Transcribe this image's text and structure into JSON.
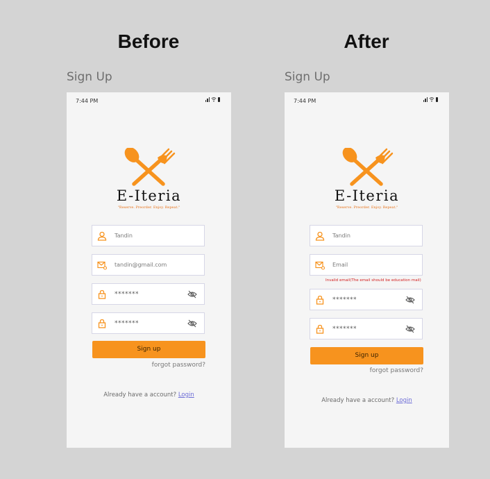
{
  "headings": {
    "before": "Before",
    "after": "After"
  },
  "before": {
    "frame_title": "Sign Up",
    "status_time": "7:44 PM",
    "brand": "E-Iteria",
    "tagline": "\"Reserve. Preorder. Enjoy. Repeat.\"",
    "username_value": "Tandin",
    "email_value": "tandin@gmail.com",
    "password_value": "*******",
    "confirm_value": "*******",
    "signup_label": "Sign up",
    "forgot_label": "forgot password?",
    "account_text": "Already have a account?",
    "login_label": "Login"
  },
  "after": {
    "frame_title": "Sign Up",
    "status_time": "7:44 PM",
    "brand": "E-Iteria",
    "tagline": "\"Reserve. Preorder. Enjoy. Repeat.\"",
    "username_value": "Tandin",
    "email_placeholder": "Email",
    "email_error": "Invalid email(The email should be education mail)",
    "password_value": "*******",
    "confirm_value": "*******",
    "signup_label": "Sign up",
    "forgot_label": "forgot password?",
    "account_text": "Already have a account?",
    "login_label": "Login"
  },
  "colors": {
    "accent": "#f7931e",
    "error": "#d32020",
    "link": "#6b6bd6",
    "background": "#d4d4d4"
  }
}
